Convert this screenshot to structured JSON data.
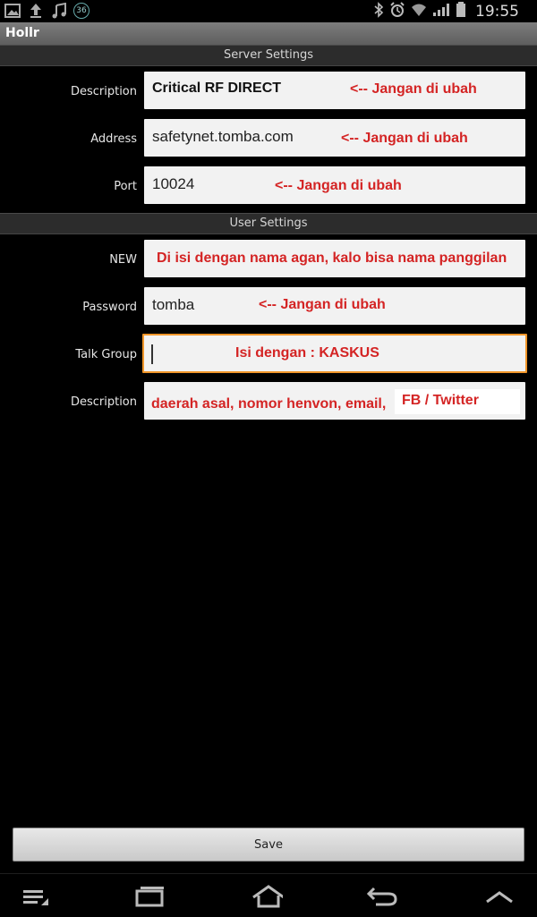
{
  "status_bar": {
    "time": "19:55",
    "badge": "36"
  },
  "app": {
    "title": "Hollr"
  },
  "server_settings": {
    "header": "Server Settings",
    "description": {
      "label": "Description",
      "value": "Critical RF DIRECT",
      "note": "<-- Jangan di ubah"
    },
    "address": {
      "label": "Address",
      "value": "safetynet.tomba.com",
      "note": "<-- Jangan di ubah"
    },
    "port": {
      "label": "Port",
      "value": "10024",
      "note": "<-- Jangan di ubah"
    }
  },
  "user_settings": {
    "header": "User Settings",
    "new": {
      "label": "NEW",
      "value": "",
      "note": "Di isi dengan nama agan, kalo bisa nama panggilan"
    },
    "password": {
      "label": "Password",
      "value": "tomba",
      "note": "<-- Jangan di ubah"
    },
    "talk_group": {
      "label": "Talk Group",
      "value": "",
      "note": "Isi dengan : KASKUS"
    },
    "description": {
      "label": "Description",
      "value": "",
      "note_1": "daerah asal, nomor henvon, email,",
      "note_2": "FB / Twitter"
    }
  },
  "save_label": "Save"
}
